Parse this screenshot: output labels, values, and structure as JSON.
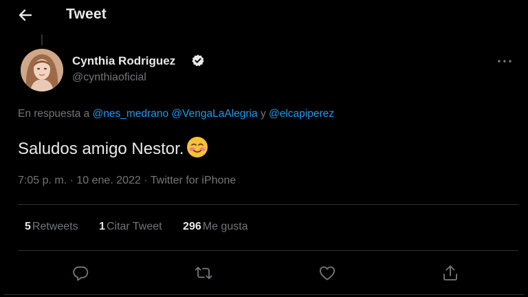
{
  "header": {
    "title": "Tweet",
    "back_icon": "back-arrow-icon"
  },
  "author": {
    "name": "Cynthia Rodriguez",
    "handle": "@cynthiaoficial",
    "verified_icon": "verified-badge-icon",
    "more_icon": "more-options-icon"
  },
  "reply": {
    "prefix": "En respuesta a",
    "mentions": [
      "@nes_medrano",
      "@VengaLaAlegria",
      "@elcapiperez"
    ],
    "conjunction": "y"
  },
  "tweet": {
    "text": "Saludos amigo Nestor.",
    "emoji_icon": "smiling-blush-emoji-icon"
  },
  "meta": {
    "time": "7:05 p. m.",
    "date": "10 ene. 2022",
    "source": "Twitter for iPhone",
    "separator": "·"
  },
  "stats": [
    {
      "count": "5",
      "label": "Retweets"
    },
    {
      "count": "1",
      "label": "Citar Tweet"
    },
    {
      "count": "296",
      "label": "Me gusta"
    }
  ],
  "actions": [
    "reply-icon",
    "retweet-icon",
    "like-icon",
    "share-icon"
  ],
  "colors": {
    "background": "#000000",
    "text": "#e7e9ea",
    "secondary": "#71767b",
    "link": "#1d9bf0",
    "divider": "#2f3336"
  }
}
